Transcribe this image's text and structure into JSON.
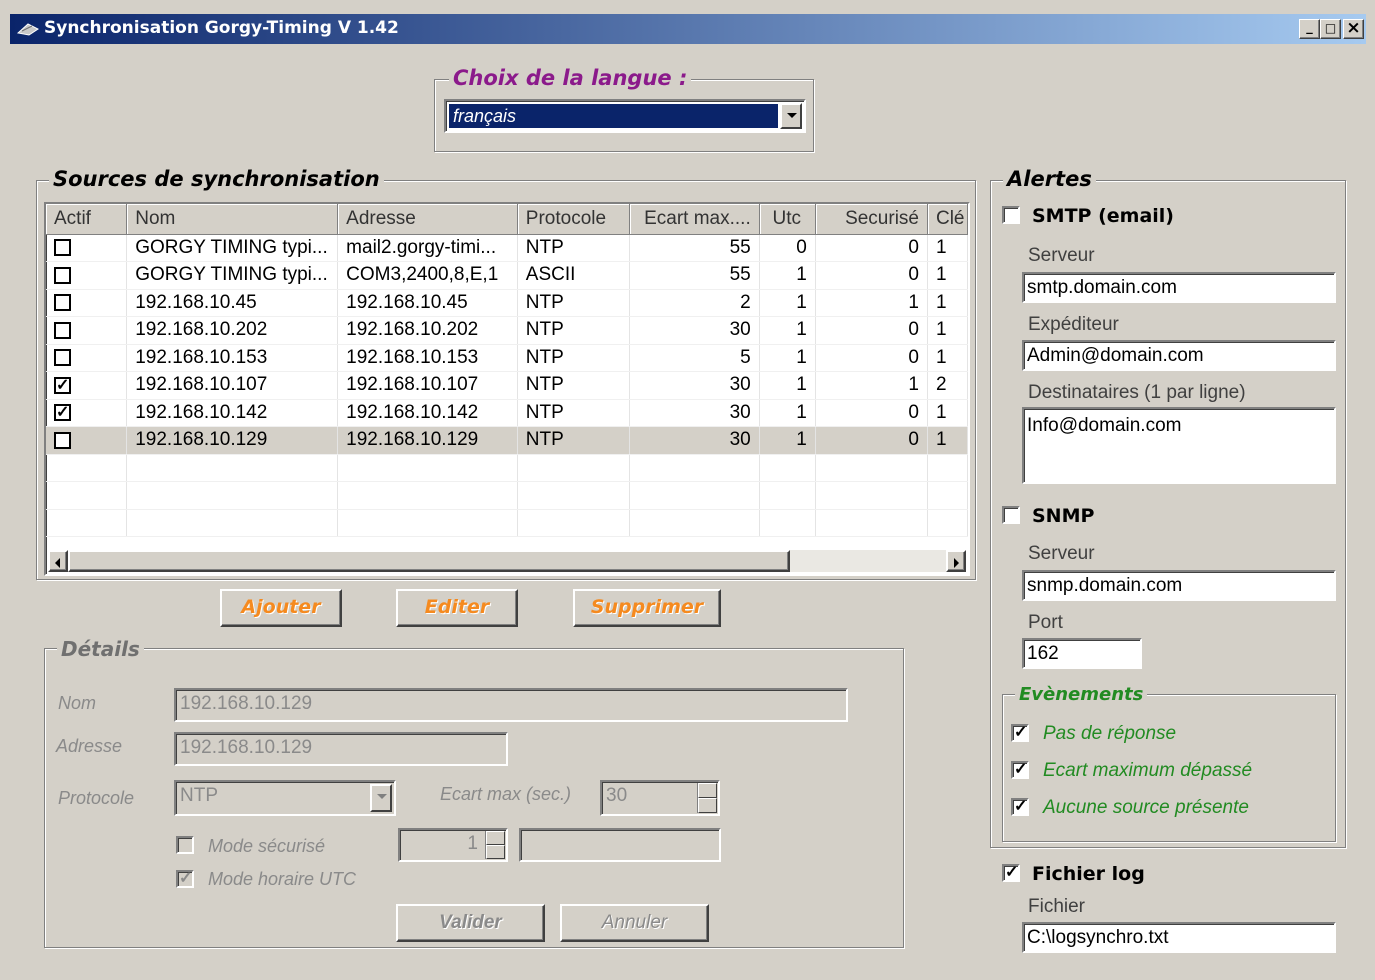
{
  "window": {
    "title": "Synchronisation Gorgy-Timing V 1.42",
    "minimize": "_",
    "maximize": "□",
    "close": "×"
  },
  "language": {
    "legend": "Choix de la langue :",
    "selected": "français"
  },
  "sources": {
    "legend": "Sources de synchronisation",
    "columns": [
      "Actif",
      "Nom",
      "Adresse",
      "Protocole",
      "Ecart max....",
      "Utc",
      "Securisé",
      "Clé"
    ],
    "rows": [
      {
        "actif": false,
        "nom": "GORGY TIMING typi...",
        "adresse": "mail2.gorgy-timi...",
        "protocole": "NTP",
        "ecart": "55",
        "utc": "0",
        "securise": "0",
        "cle": "1"
      },
      {
        "actif": false,
        "nom": "GORGY TIMING typi...",
        "adresse": "COM3,2400,8,E,1",
        "protocole": "ASCII",
        "ecart": "55",
        "utc": "1",
        "securise": "0",
        "cle": "1"
      },
      {
        "actif": false,
        "nom": "192.168.10.45",
        "adresse": "192.168.10.45",
        "protocole": "NTP",
        "ecart": "2",
        "utc": "1",
        "securise": "1",
        "cle": "1"
      },
      {
        "actif": false,
        "nom": "192.168.10.202",
        "adresse": "192.168.10.202",
        "protocole": "NTP",
        "ecart": "30",
        "utc": "1",
        "securise": "0",
        "cle": "1"
      },
      {
        "actif": false,
        "nom": "192.168.10.153",
        "adresse": "192.168.10.153",
        "protocole": "NTP",
        "ecart": "5",
        "utc": "1",
        "securise": "0",
        "cle": "1"
      },
      {
        "actif": true,
        "nom": "192.168.10.107",
        "adresse": "192.168.10.107",
        "protocole": "NTP",
        "ecart": "30",
        "utc": "1",
        "securise": "1",
        "cle": "2"
      },
      {
        "actif": true,
        "nom": "192.168.10.142",
        "adresse": "192.168.10.142",
        "protocole": "NTP",
        "ecart": "30",
        "utc": "1",
        "securise": "0",
        "cle": "1"
      },
      {
        "actif": false,
        "nom": "192.168.10.129",
        "adresse": "192.168.10.129",
        "protocole": "NTP",
        "ecart": "30",
        "utc": "1",
        "securise": "0",
        "cle": "1",
        "selected": true
      }
    ],
    "empty_rows": 3
  },
  "actions": {
    "ajouter": "Ajouter",
    "editer": "Editer",
    "supprimer": "Supprimer"
  },
  "details": {
    "legend": "Détails",
    "nom_label": "Nom",
    "nom_value": "192.168.10.129",
    "adresse_label": "Adresse",
    "adresse_value": "192.168.10.129",
    "protocole_label": "Protocole",
    "protocole_value": "NTP",
    "ecart_label": "Ecart max (sec.)",
    "ecart_value": "30",
    "mode_securise_label": "Mode sécurisé",
    "mode_securise_checked": false,
    "cle_value": "1",
    "cle_text": "",
    "mode_utc_label": "Mode horaire UTC",
    "mode_utc_checked": true,
    "valider": "Valider",
    "annuler": "Annuler"
  },
  "alertes": {
    "legend": "Alertes",
    "smtp": {
      "label": "SMTP (email)",
      "checked": false,
      "serveur_label": "Serveur",
      "serveur": "smtp.domain.com",
      "expediteur_label": "Expéditeur",
      "expediteur": "Admin@domain.com",
      "destinataires_label": "Destinataires (1 par ligne)",
      "destinataires": "Info@domain.com"
    },
    "snmp": {
      "label": "SNMP",
      "checked": false,
      "serveur_label": "Serveur",
      "serveur": "snmp.domain.com",
      "port_label": "Port",
      "port": "162"
    },
    "evenements": {
      "legend": "Evènements",
      "items": [
        {
          "label": "Pas de réponse",
          "checked": true
        },
        {
          "label": "Ecart maximum dépassé",
          "checked": true
        },
        {
          "label": "Aucune source présente",
          "checked": true
        }
      ]
    },
    "log": {
      "label": "Fichier log",
      "checked": true,
      "fichier_label": "Fichier",
      "fichier": "C:\\logsynchro.txt"
    }
  },
  "colors": {
    "title_gradient_start": "#0a246a",
    "title_gradient_end": "#a6caf0",
    "button_accent": "#f58a1f",
    "legend_purple": "#8b1a8b",
    "event_green": "#228b22"
  }
}
